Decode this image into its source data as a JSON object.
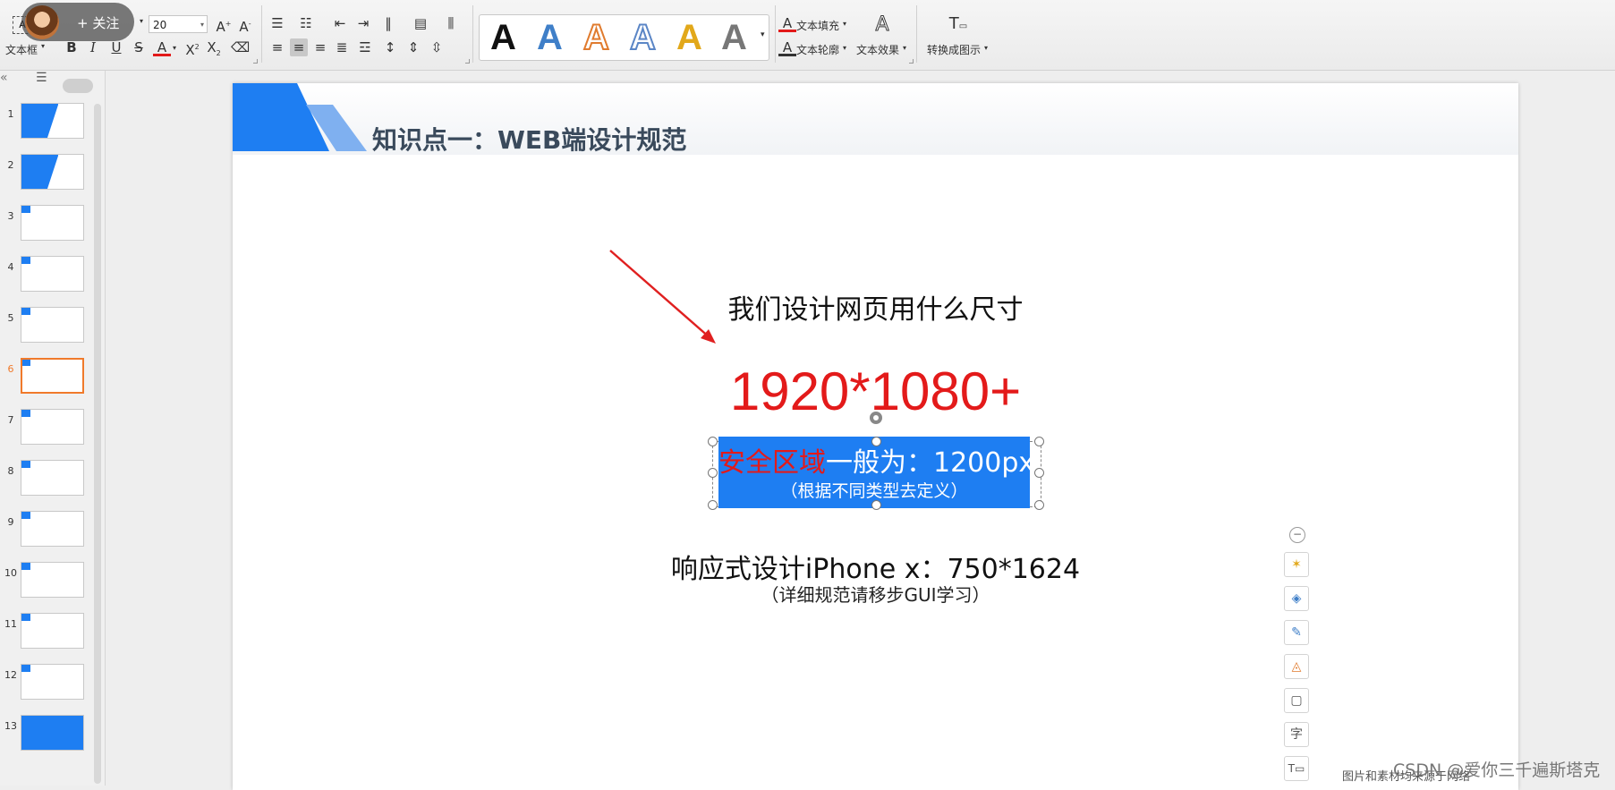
{
  "ribbon": {
    "text_box_label": "文本框",
    "font_size": "20",
    "text_fill_label": "文本填充",
    "text_outline_label": "文本轮廓",
    "text_effect_label": "文本效果",
    "convert_label": "转换成图示",
    "follow_label": "+ 关注",
    "wordart_glyph": "A",
    "wordart_colors": [
      "#111111",
      "#3f7fc8",
      "#e07b2e",
      "#5b86c6",
      "#e2a81a",
      "#777777"
    ]
  },
  "slides_panel": {
    "thumbnails": [
      {
        "num": "1"
      },
      {
        "num": "2"
      },
      {
        "num": "3"
      },
      {
        "num": "4"
      },
      {
        "num": "5"
      },
      {
        "num": "6"
      },
      {
        "num": "7"
      },
      {
        "num": "8"
      },
      {
        "num": "9"
      },
      {
        "num": "10"
      },
      {
        "num": "11"
      },
      {
        "num": "12"
      },
      {
        "num": "13"
      }
    ],
    "selected": "6"
  },
  "slide": {
    "title": "知识点一：WEB端设计规范",
    "question": "我们设计网页用什么尺寸",
    "size": "1920*1080+",
    "safe_red": "安全区域",
    "safe_rest": "一般为：1200px",
    "safe_note": "（根据不同类型去定义）",
    "responsive": "响应式设计iPhone x：750*1624",
    "responsive_note": "（详细规范请移步GUI学习）",
    "accent": "#1e7ef2",
    "highlight": "#e31a1a"
  },
  "overlay": {
    "watermark": "CSDN @爱你三千遍斯塔克",
    "footer_note": "图片和素材均来源于网络"
  }
}
